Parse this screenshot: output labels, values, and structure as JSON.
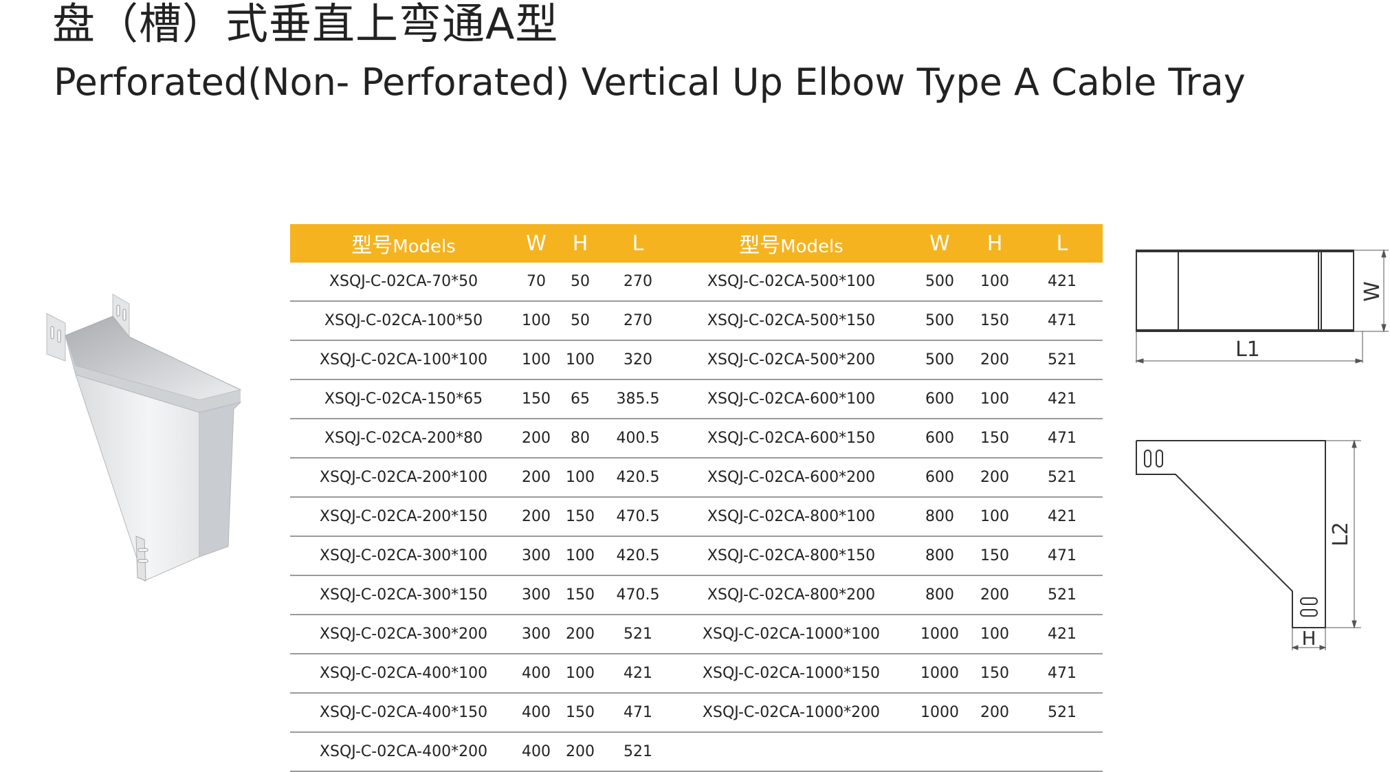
{
  "title_cn": "盘（槽）式垂直上弯通A型",
  "title_en": "Perforated(Non- Perforated) Vertical Up Elbow Type A Cable Tray",
  "table": {
    "headers": {
      "model_cn": "型号",
      "model_en": "Models",
      "w": "W",
      "h": "H",
      "l": "L"
    },
    "rows": [
      {
        "left": {
          "model": "XSQJ-C-02CA-70*50",
          "w": "70",
          "h": "50",
          "l": "270"
        },
        "right": {
          "model": "XSQJ-C-02CA-500*100",
          "w": "500",
          "h": "100",
          "l": "421"
        }
      },
      {
        "left": {
          "model": "XSQJ-C-02CA-100*50",
          "w": "100",
          "h": "50",
          "l": "270"
        },
        "right": {
          "model": "XSQJ-C-02CA-500*150",
          "w": "500",
          "h": "150",
          "l": "471"
        }
      },
      {
        "left": {
          "model": "XSQJ-C-02CA-100*100",
          "w": "100",
          "h": "100",
          "l": "320"
        },
        "right": {
          "model": "XSQJ-C-02CA-500*200",
          "w": "500",
          "h": "200",
          "l": "521"
        }
      },
      {
        "left": {
          "model": "XSQJ-C-02CA-150*65",
          "w": "150",
          "h": "65",
          "l": "385.5"
        },
        "right": {
          "model": "XSQJ-C-02CA-600*100",
          "w": "600",
          "h": "100",
          "l": "421"
        }
      },
      {
        "left": {
          "model": "XSQJ-C-02CA-200*80",
          "w": "200",
          "h": "80",
          "l": "400.5"
        },
        "right": {
          "model": "XSQJ-C-02CA-600*150",
          "w": "600",
          "h": "150",
          "l": "471"
        }
      },
      {
        "left": {
          "model": "XSQJ-C-02CA-200*100",
          "w": "200",
          "h": "100",
          "l": "420.5"
        },
        "right": {
          "model": "XSQJ-C-02CA-600*200",
          "w": "600",
          "h": "200",
          "l": "521"
        }
      },
      {
        "left": {
          "model": "XSQJ-C-02CA-200*150",
          "w": "200",
          "h": "150",
          "l": "470.5"
        },
        "right": {
          "model": "XSQJ-C-02CA-800*100",
          "w": "800",
          "h": "100",
          "l": "421"
        }
      },
      {
        "left": {
          "model": "XSQJ-C-02CA-300*100",
          "w": "300",
          "h": "100",
          "l": "420.5"
        },
        "right": {
          "model": "XSQJ-C-02CA-800*150",
          "w": "800",
          "h": "150",
          "l": "471"
        }
      },
      {
        "left": {
          "model": "XSQJ-C-02CA-300*150",
          "w": "300",
          "h": "150",
          "l": "470.5"
        },
        "right": {
          "model": "XSQJ-C-02CA-800*200",
          "w": "800",
          "h": "200",
          "l": "521"
        }
      },
      {
        "left": {
          "model": "XSQJ-C-02CA-300*200",
          "w": "300",
          "h": "200",
          "l": "521"
        },
        "right": {
          "model": "XSQJ-C-02CA-1000*100",
          "w": "1000",
          "h": "100",
          "l": "421"
        }
      },
      {
        "left": {
          "model": "XSQJ-C-02CA-400*100",
          "w": "400",
          "h": "100",
          "l": "421"
        },
        "right": {
          "model": "XSQJ-C-02CA-1000*150",
          "w": "1000",
          "h": "150",
          "l": "471"
        }
      },
      {
        "left": {
          "model": "XSQJ-C-02CA-400*150",
          "w": "400",
          "h": "150",
          "l": "471"
        },
        "right": {
          "model": "XSQJ-C-02CA-1000*200",
          "w": "1000",
          "h": "200",
          "l": "521"
        }
      },
      {
        "left": {
          "model": "XSQJ-C-02CA-400*200",
          "w": "400",
          "h": "200",
          "l": "521"
        },
        "right": {
          "model": "",
          "w": "",
          "h": "",
          "l": ""
        }
      }
    ]
  },
  "drawing_labels": {
    "w": "W",
    "l1": "L1",
    "l2": "L2",
    "h": "H"
  },
  "colors": {
    "header_bg": "#f5b320",
    "header_text": "#ffffff",
    "row_rule": "#9a9a9a"
  }
}
